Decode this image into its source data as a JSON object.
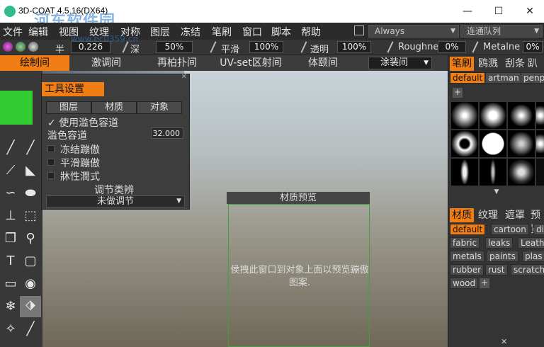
{
  "window": {
    "title": "3D-COAT 4.5.16(DX64)",
    "watermark_cn": "河东软件园",
    "watermark_url": "www.pc0359.cn"
  },
  "menubar": {
    "items": [
      "文件",
      "编辑",
      "视图",
      "纹理",
      "对称",
      "图层",
      "冻结",
      "笔刷",
      "窗口",
      "脚本",
      "帮助"
    ],
    "combo1": "Always",
    "combo2": "连通队列"
  },
  "toolbar": {
    "size_label": "半",
    "size_value": "0.226",
    "depth_label": "深",
    "depth_value": "50%",
    "smooth_label": "平滑",
    "smooth_value": "100%",
    "opacity_label": "透明",
    "opacity_value": "100%",
    "roughness_label": "Roughne",
    "roughness_value": "0%",
    "metalness_label": "Metalne",
    "metalness_value": "0%"
  },
  "tabs": {
    "items": [
      "绘制间",
      "激调间",
      "再柏扑间",
      "UV-set区射间",
      "体颐间"
    ],
    "dropdown": "涂装间"
  },
  "tool_panel": {
    "title": "工具设置",
    "tabs": [
      "图层",
      "材质",
      "对象"
    ],
    "use_color_label": "使用滥色容道",
    "tolerance_label": "滥色容道",
    "tolerance_value": "32.000",
    "freeze_label": "冻结蹦傲",
    "smooth_label": "平滑蹦傲",
    "sharpen_label": "牀性潤式",
    "adjust_label": "调节类辨",
    "adjust_select": "未做调节"
  },
  "material_preview": {
    "title": "材质预览",
    "hint": "侯拽此窗口到对象上面以预览蹦傲图案."
  },
  "right_panel": {
    "brush_tabs": [
      "笔刷",
      "鸥溅",
      "刮条",
      "趴用"
    ],
    "brush_presets": [
      "default",
      "artman",
      "penpa"
    ],
    "material_tabs": [
      "材质",
      "纹理",
      "遮罩",
      "预览"
    ],
    "materials": [
      "default",
      "cartoon",
      "di",
      "fabric",
      "leaks",
      "Leath",
      "metals",
      "paints",
      "plas",
      "rubber",
      "rust",
      "scratch",
      "wood"
    ]
  },
  "colors": {
    "accent": "#f07e14",
    "swatch": "#33cc33"
  }
}
